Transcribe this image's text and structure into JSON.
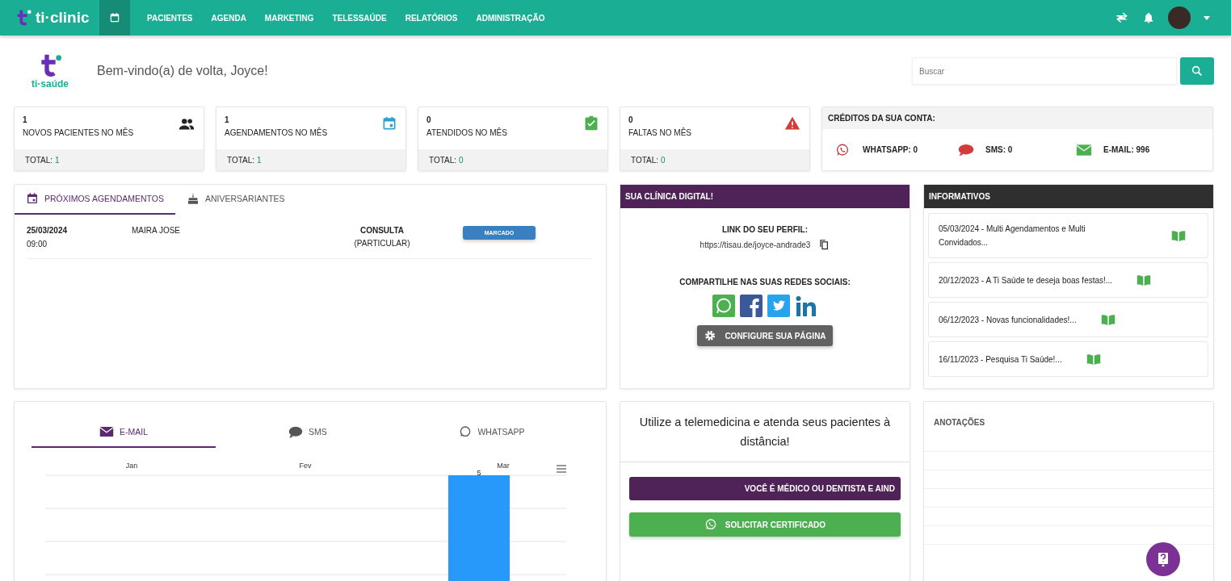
{
  "navbar": {
    "brand": "ti·clinic",
    "items": [
      {
        "label": "PACIENTES",
        "selected": false
      },
      {
        "label": "AGENDA",
        "selected": false
      },
      {
        "label": "MARKETING",
        "selected": false
      },
      {
        "label": "TELESSAÚDE",
        "selected": false
      },
      {
        "label": "RELATÓRIOS",
        "selected": false
      },
      {
        "label": "ADMINISTRAÇÃO",
        "selected": false
      }
    ]
  },
  "header": {
    "logo_text": "ti·saúde",
    "welcome": "Bem-vindo(a) de volta, Joyce!",
    "search": {
      "placeholder": "Buscar"
    }
  },
  "stats": [
    {
      "value": "1",
      "label": "NOVOS PACIENTES NO MÊS",
      "total_label": "TOTAL:",
      "total_value": "1"
    },
    {
      "value": "1",
      "label": "AGENDAMENTOS NO MÊS",
      "total_label": "TOTAL:",
      "total_value": "1"
    },
    {
      "value": "0",
      "label": "ATENDIDOS NO MÊS",
      "total_label": "TOTAL:",
      "total_value": "0"
    },
    {
      "value": "0",
      "label": "FALTAS NO MÊS",
      "total_label": "TOTAL:",
      "total_value": "0"
    }
  ],
  "credits": {
    "title": "CRÉDITOS DA SUA CONTA:",
    "items": [
      "WHATSAPP: 0",
      "SMS: 0",
      "E-MAIL: 996"
    ]
  },
  "schedule": {
    "tabs": [
      {
        "label": "PRÓXIMOS AGENDAMENTOS",
        "selected": true
      },
      {
        "label": "ANIVERSARIANTES",
        "selected": false
      }
    ],
    "rows": [
      {
        "date": "25/03/2024",
        "time": "09:00",
        "patient": "MAIRA JOSE",
        "type": "CONSULTA",
        "payment": "(PARTICULAR)",
        "status": "MARCADO"
      }
    ]
  },
  "clinic": {
    "title": "SUA CLÍNICA DIGITAL!",
    "link_label": "LINK DO SEU PERFIL:",
    "link": "https://tisau.de/joyce-andrade3",
    "share_label": "COMPARTILHE NAS SUAS REDES SOCIAIS:",
    "configure_button": "CONFIGURE SUA PÁGINA"
  },
  "news": {
    "title": "INFORMATIVOS",
    "items": [
      "05/03/2024 - Multi Agendamentos e Multi Convidados...",
      "20/12/2023 - A Ti Saúde te deseja boas festas!...",
      "06/12/2023 - Novas funcionalidades!...",
      "16/11/2023 - Pesquisa Ti Saúde!..."
    ]
  },
  "messages": {
    "tabs": [
      {
        "label": "E-MAIL",
        "selected": true
      },
      {
        "label": "SMS",
        "selected": false
      },
      {
        "label": "WHATSAPP",
        "selected": false
      }
    ],
    "chart_data": {
      "type": "bar",
      "categories": [
        "Jan",
        "Fev",
        "Mar"
      ],
      "values": [
        null,
        null,
        5
      ],
      "data_labels": true
    }
  },
  "telemedicine": {
    "title": "Utilize a telemedicina e atenda seus pacientes à distância!",
    "banner": "VOCÊ É MÉDICO OU DENTISTA E AIND",
    "certificate_button": "SOLICITAR CERTIFICADO"
  },
  "notes": {
    "title": "ANOTAÇÕES"
  }
}
